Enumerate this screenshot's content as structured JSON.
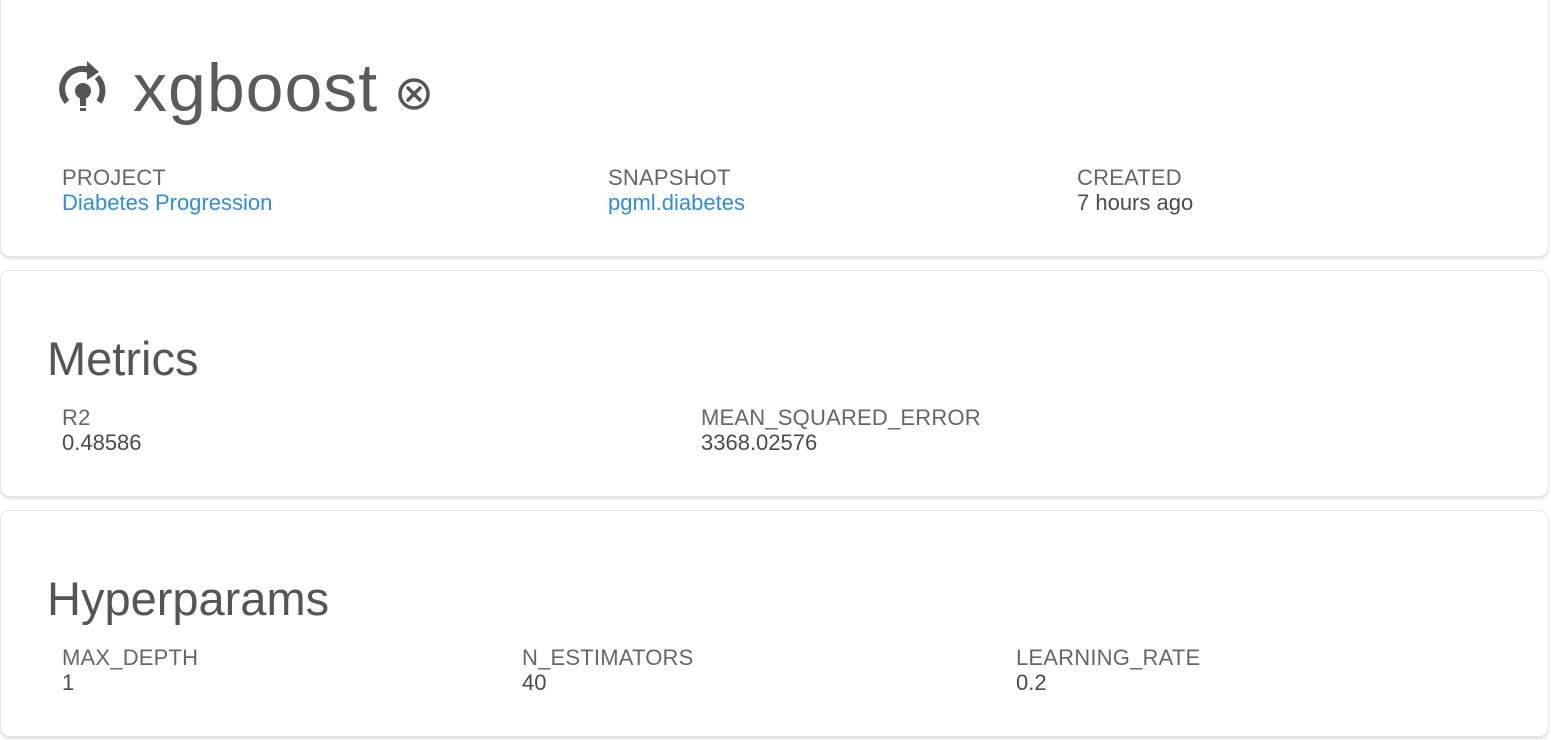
{
  "model": {
    "name": "xgboost",
    "icon": "deploy-model-icon",
    "action_icon": "circle-x-icon",
    "fields": {
      "project": {
        "label": "PROJECT",
        "value": "Diabetes Progression"
      },
      "snapshot": {
        "label": "SNAPSHOT",
        "value": "pgml.diabetes"
      },
      "created": {
        "label": "CREATED",
        "value": "7 hours ago"
      }
    }
  },
  "metrics": {
    "heading": "Metrics",
    "items": [
      {
        "label": "R2",
        "value": "0.48586"
      },
      {
        "label": "MEAN_SQUARED_ERROR",
        "value": "3368.02576"
      }
    ]
  },
  "hyperparams": {
    "heading": "Hyperparams",
    "items": [
      {
        "label": "MAX_DEPTH",
        "value": "1"
      },
      {
        "label": "N_ESTIMATORS",
        "value": "40"
      },
      {
        "label": "LEARNING_RATE",
        "value": "0.2"
      }
    ]
  },
  "colors": {
    "link": "#2d8de0",
    "text": "#555555",
    "border": "#e6e6e6"
  }
}
